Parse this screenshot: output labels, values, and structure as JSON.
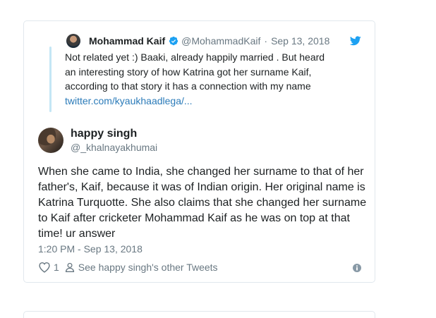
{
  "quoted_tweet": {
    "author_name": "Mohammad Kaif",
    "author_handle": "@MohammadKaif",
    "separator": "·",
    "date": "Sep 13, 2018",
    "text_lines": [
      "Not related yet :) Baaki, already happily married . But heard",
      "an interesting story of how Katrina got her surname Kaif,",
      "according to that story it has a connection with my name"
    ],
    "link": "twitter.com/kyaukhaadlega/..."
  },
  "tweet": {
    "author_name": "happy singh",
    "author_handle": "@_khalnayakhumai",
    "text": "When she came to India, she changed her surname to that of her father's, Kaif, because it was of Indian origin. Her original name is Katrina Turquotte. She also claims that she changed her surname to Kaif after cricketer Mohammad Kaif as he was on top at that time! ur answer",
    "timestamp": "1:20 PM - Sep 13, 2018",
    "like_count": "1",
    "other_tweets_label": "See happy singh's other Tweets"
  },
  "colors": {
    "link": "#2b7bb9",
    "muted": "#697882",
    "border": "#e1e8ed",
    "verified": "#1da1f2",
    "quote_bar": "#c4e6f5"
  },
  "icons": {
    "verified": "verified-badge-icon",
    "bird": "twitter-bird-icon",
    "like": "heart-icon",
    "profile": "person-icon",
    "info": "info-icon"
  }
}
